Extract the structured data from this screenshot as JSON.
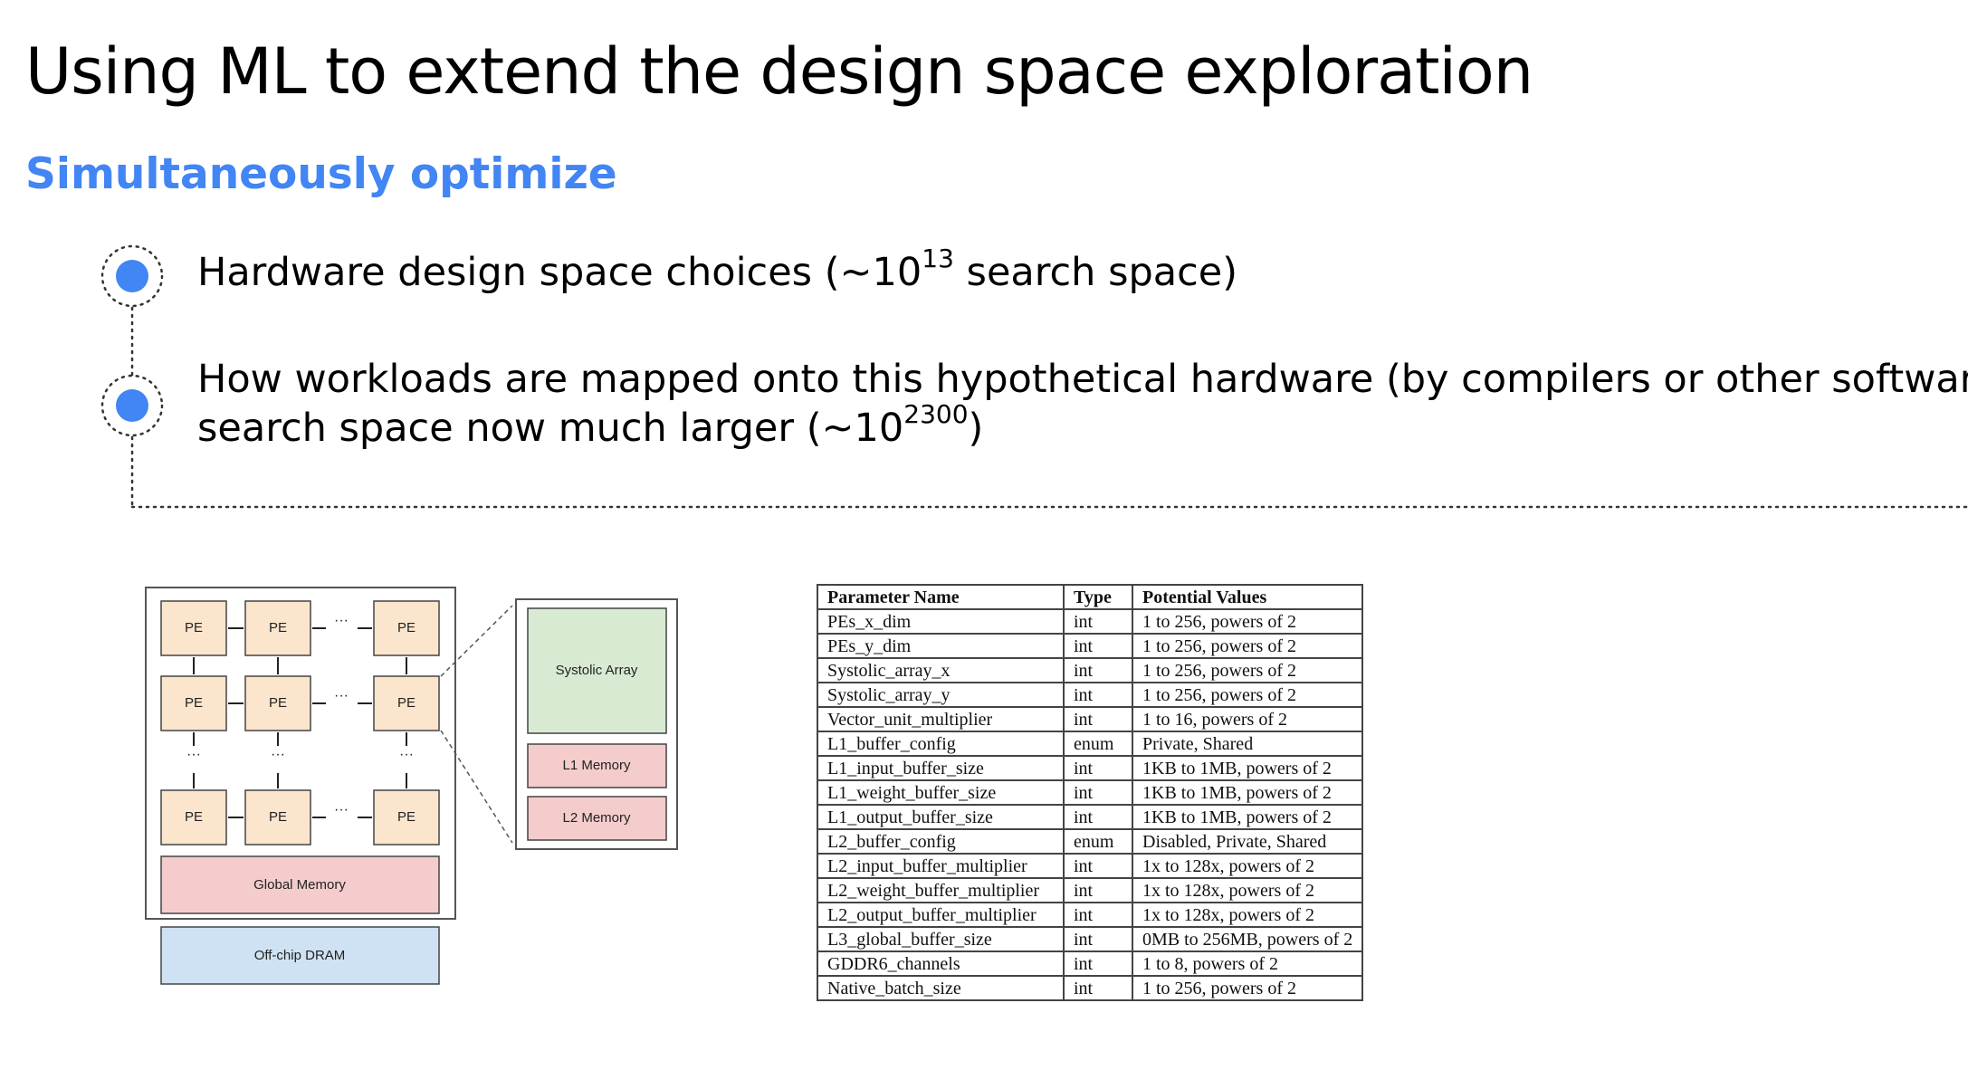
{
  "slide": {
    "title": "Using ML to extend the design space exploration",
    "subtitle": "Simultaneously optimize",
    "accent_color": "#4285f4",
    "bullets": [
      {
        "prefix": "Hardware design space choices (~10",
        "exponent": "13",
        "suffix": " search space)"
      },
      {
        "line1": "How workloads are mapped onto this hypothetical hardware (by compilers or other software):",
        "prefix": "search space now much larger (~10",
        "exponent": "2300",
        "suffix": ")"
      }
    ]
  },
  "diagram": {
    "pe_label": "PE",
    "ellipsis": "···",
    "global_memory": "Global Memory",
    "offchip": "Off-chip DRAM",
    "systolic": "Systolic Array",
    "l1": "L1 Memory",
    "l2": "L2 Memory",
    "colors": {
      "pe": "#fce5cd",
      "memory": "#f4cccc",
      "dram": "#cfe2f3",
      "systolic": "#d9ead3"
    }
  },
  "table": {
    "headers": [
      "Parameter Name",
      "Type",
      "Potential Values"
    ],
    "rows": [
      [
        "PEs_x_dim",
        "int",
        "1 to 256, powers of 2"
      ],
      [
        "PEs_y_dim",
        "int",
        "1 to 256, powers of 2"
      ],
      [
        "Systolic_array_x",
        "int",
        "1 to 256, powers of 2"
      ],
      [
        "Systolic_array_y",
        "int",
        "1 to 256, powers of 2"
      ],
      [
        "Vector_unit_multiplier",
        "int",
        "1 to 16, powers of 2"
      ],
      [
        "L1_buffer_config",
        "enum",
        "Private, Shared"
      ],
      [
        "L1_input_buffer_size",
        "int",
        "1KB to 1MB, powers of 2"
      ],
      [
        "L1_weight_buffer_size",
        "int",
        "1KB to 1MB, powers of 2"
      ],
      [
        "L1_output_buffer_size",
        "int",
        "1KB to 1MB, powers of 2"
      ],
      [
        "L2_buffer_config",
        "enum",
        "Disabled, Private, Shared"
      ],
      [
        "L2_input_buffer_multiplier",
        "int",
        "1x to 128x, powers of 2"
      ],
      [
        "L2_weight_buffer_multiplier",
        "int",
        "1x to 128x, powers of 2"
      ],
      [
        "L2_output_buffer_multiplier",
        "int",
        "1x to 128x, powers of 2"
      ],
      [
        "L3_global_buffer_size",
        "int",
        "0MB to 256MB, powers of 2"
      ],
      [
        "GDDR6_channels",
        "int",
        "1 to 8, powers of 2"
      ],
      [
        "Native_batch_size",
        "int",
        "1 to 256, powers of 2"
      ]
    ]
  }
}
